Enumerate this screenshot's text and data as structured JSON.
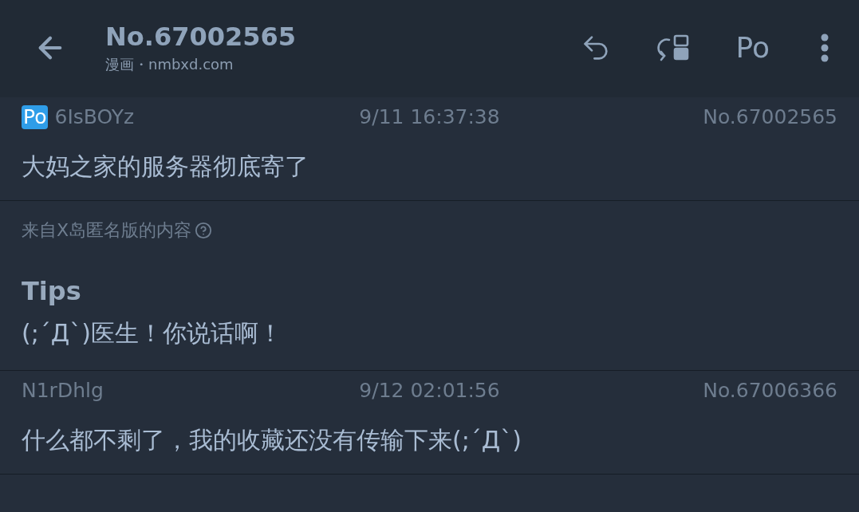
{
  "header": {
    "title": "No.67002565",
    "subtitle": "漫画・nmbxd.com",
    "actions": [
      {
        "kind": "reply"
      },
      {
        "kind": "jump"
      },
      {
        "kind": "text",
        "label": "Po"
      },
      {
        "kind": "more"
      }
    ]
  },
  "items": [
    {
      "kind": "post",
      "po": true,
      "badge": "Po",
      "user": "6IsBOYz",
      "time": "9/11 16:37:38",
      "number": "No.67002565",
      "content": "大妈之家的服务器彻底寄了"
    },
    {
      "kind": "notice",
      "source": "来自X岛匿名版的内容",
      "heading": "Tips",
      "text": "(;´Д`)医生！你说话啊！"
    },
    {
      "kind": "post",
      "po": false,
      "user": "N1rDhlg",
      "time": "9/12 02:01:56",
      "number": "No.67006366",
      "content": "什么都不剩了，我的收藏还没有传输下来(;´Д`)"
    }
  ]
}
